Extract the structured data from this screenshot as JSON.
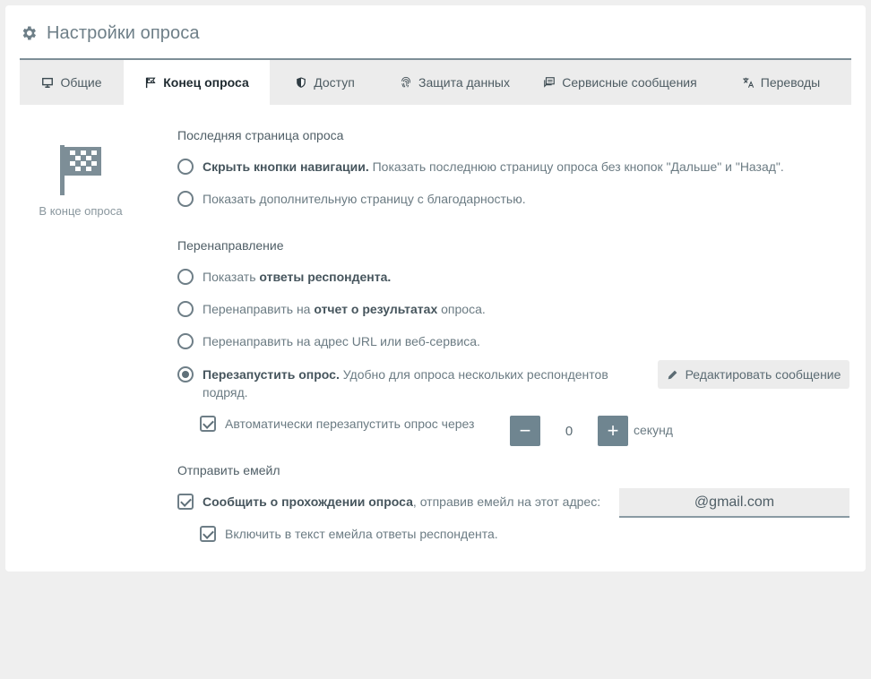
{
  "header": {
    "title": "Настройки опроса",
    "icon": "gear-icon"
  },
  "tabs": [
    {
      "label": "Общие",
      "icon": "monitor-icon",
      "active": false
    },
    {
      "label": "Конец опроса",
      "icon": "flag-icon",
      "active": true
    },
    {
      "label": "Доступ",
      "icon": "shield-icon",
      "active": false
    },
    {
      "label": "Защита данных",
      "icon": "fingerprint-icon",
      "active": false
    },
    {
      "label": "Сервисные сообщения",
      "icon": "messages-icon",
      "active": false
    },
    {
      "label": "Переводы",
      "icon": "translate-icon",
      "active": false
    }
  ],
  "side": {
    "label": "В конце опроса",
    "icon": "checkered-flag-icon"
  },
  "last_page": {
    "title": "Последняя страница опроса",
    "opt1_bold": "Скрыть кнопки навигации.",
    "opt1_text": " Показать последнюю страницу опроса без кнопок \"Дальше\" и \"Назад\".",
    "opt2_text": "Показать дополнительную страницу с благодарностью."
  },
  "redirect": {
    "title": "Перенаправление",
    "opt1_pre": "Показать ",
    "opt1_bold": "ответы респондента.",
    "opt2_pre": "Перенаправить на ",
    "opt2_bold": "отчет о результатах",
    "opt2_post": " опроса.",
    "opt3_text": "Перенаправить на адрес URL или веб-сервиса.",
    "opt4_bold": "Перезапустить опрос.",
    "opt4_text": " Удобно для опроса нескольких респондентов подряд.",
    "edit_label": "Редактировать сообщение",
    "auto_label": "Автоматически перезапустить опрос через",
    "minus": "−",
    "plus": "+",
    "seconds_value": "0",
    "seconds_label": "секунд"
  },
  "email": {
    "title": "Отправить емейл",
    "notify_bold": "Сообщить о прохождении опроса",
    "notify_text": ", отправив емейл на этот адрес:",
    "address": "@gmail.com",
    "include_text": "Включить в текст емейла ответы респондента."
  },
  "colors": {
    "accent": "#6f8590",
    "tab_bg": "#ececec",
    "page_bg": "#efefef"
  }
}
